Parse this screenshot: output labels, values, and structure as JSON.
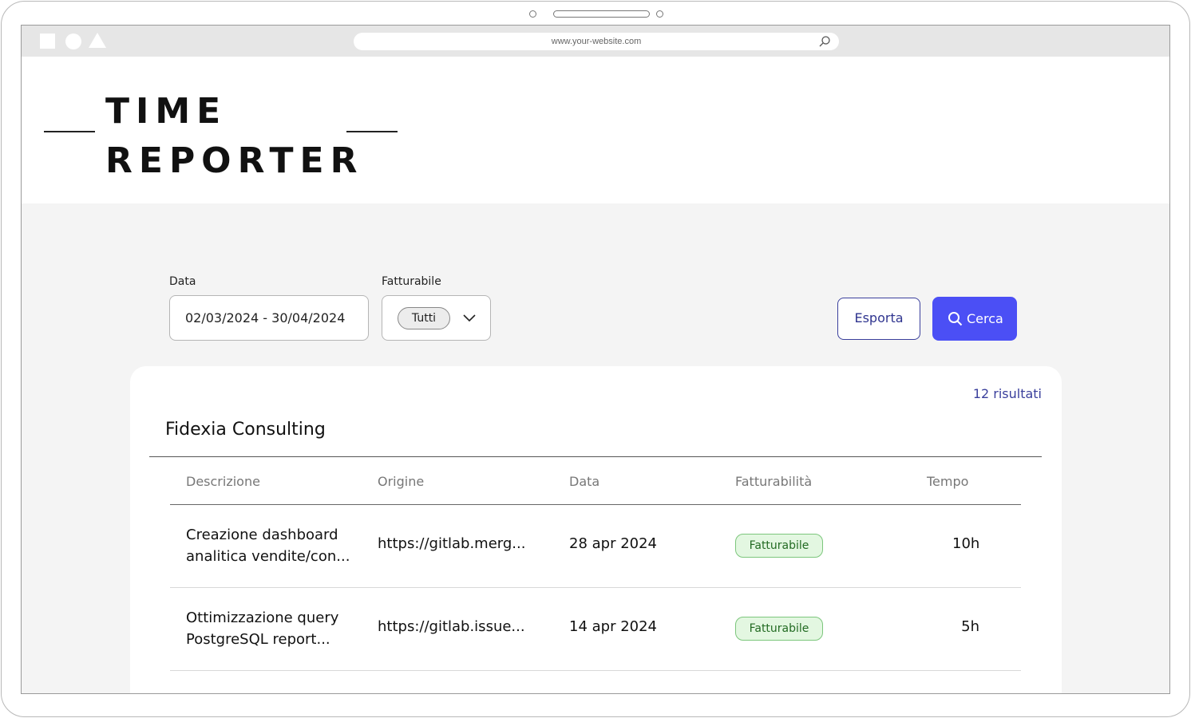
{
  "browser": {
    "url": "www.your-website.com"
  },
  "app": {
    "logo_line1": "TIME",
    "logo_line2": "REPORTER"
  },
  "filters": {
    "date_label": "Data",
    "date_value": "02/03/2024 - 30/04/2024",
    "billable_label": "Fatturabile",
    "billable_selected": "Tutti"
  },
  "actions": {
    "export_label": "Esporta",
    "search_label": "Cerca"
  },
  "results": {
    "count_label": "12 risultati",
    "client": "Fidexia Consulting",
    "columns": [
      "Descrizione",
      "Origine",
      "Data",
      "Fatturabilità",
      "Tempo"
    ],
    "rows": [
      {
        "desc_line1": "Creazione dashboard",
        "desc_line2": "analitica vendite/con...",
        "origin": "https://gitlab.merg...",
        "date": "28 apr 2024",
        "billable": "Fatturabile",
        "time": "10h"
      },
      {
        "desc_line1": "Ottimizzazione query",
        "desc_line2": "PostgreSQL report...",
        "origin": "https://gitlab.issue...",
        "date": "14 apr 2024",
        "billable": "Fatturabile",
        "time": "5h"
      }
    ]
  },
  "colors": {
    "accent": "#4b4ff5",
    "accent_text": "#3a3f9c",
    "badge_bg": "#e3f7e1",
    "badge_text": "#236b23"
  }
}
